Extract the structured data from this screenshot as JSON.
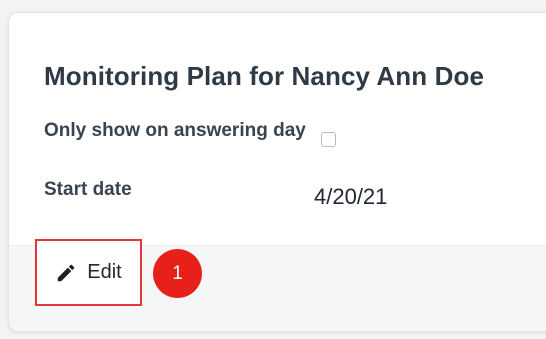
{
  "card": {
    "title": "Monitoring Plan for Nancy Ann Doe",
    "fields": {
      "only_show_label": "Only show on answering day",
      "only_show_checked": false,
      "start_date_label": "Start date",
      "start_date_value": "4/20/21"
    }
  },
  "footer": {
    "edit_label": "Edit",
    "edit_icon": "pencil-icon",
    "step_badge": "1"
  },
  "colors": {
    "highlight_border": "#e1383a",
    "badge_background": "#e8201a",
    "footer_background": "#f5f6f7"
  }
}
